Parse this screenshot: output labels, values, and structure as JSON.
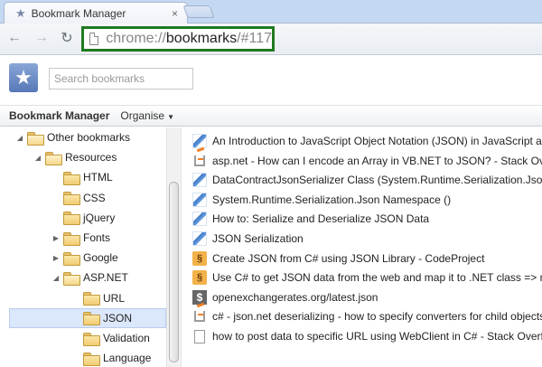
{
  "tab": {
    "title": "Bookmark Manager",
    "icon": "star-icon",
    "close": "×"
  },
  "nav": {
    "back": "←",
    "forward": "→",
    "reload": "↻"
  },
  "omnibox": {
    "scheme": "chrome://",
    "host": "bookmarks",
    "path": "/#117",
    "highlight_color": "#1f7a1f"
  },
  "header": {
    "logo_glyph": "★",
    "search_placeholder": "Search bookmarks"
  },
  "titlebar": {
    "title": "Bookmark Manager",
    "organise": "Organise",
    "organise_caret": "▼"
  },
  "tree": {
    "items": [
      {
        "label": "Other bookmarks",
        "expanded": true,
        "twisty": "◢",
        "level": 0
      },
      {
        "label": "Resources",
        "expanded": true,
        "twisty": "◢",
        "level": 1
      },
      {
        "label": "HTML",
        "twisty": "",
        "level": 2
      },
      {
        "label": "CSS",
        "twisty": "",
        "level": 2
      },
      {
        "label": "jQuery",
        "twisty": "",
        "level": 2
      },
      {
        "label": "Fonts",
        "twisty": "▶",
        "level": 2
      },
      {
        "label": "Google",
        "twisty": "▶",
        "level": 2
      },
      {
        "label": "ASP.NET",
        "expanded": true,
        "twisty": "◢",
        "level": 2
      },
      {
        "label": "URL",
        "twisty": "",
        "level": 3
      },
      {
        "label": "JSON",
        "twisty": "",
        "level": 3,
        "selected": true
      },
      {
        "label": "Validation",
        "twisty": "",
        "level": 3
      },
      {
        "label": "Language",
        "twisty": "",
        "level": 3
      }
    ]
  },
  "bookmarks": [
    {
      "title": "An Introduction to JavaScript Object Notation (JSON) in JavaScript and .NET",
      "icon": "msdn-icon"
    },
    {
      "title": "asp.net - How can I encode an Array in VB.NET to JSON? - Stack Overflow",
      "icon": "stackoverflow-icon"
    },
    {
      "title": "DataContractJsonSerializer Class (System.Runtime.Serialization.Json)",
      "icon": "msdn-icon"
    },
    {
      "title": "System.Runtime.Serialization.Json Namespace ()",
      "icon": "msdn-icon"
    },
    {
      "title": "How to: Serialize and Deserialize JSON Data",
      "icon": "msdn-icon"
    },
    {
      "title": "JSON Serialization",
      "icon": "msdn-icon"
    },
    {
      "title": "Create JSON from C# using JSON Library - CodeProject",
      "icon": "codeproject-icon"
    },
    {
      "title": "Use C# to get JSON data from the web and map it to .NET class => made easy",
      "icon": "codeproject-icon"
    },
    {
      "title": "openexchangerates.org/latest.json",
      "icon": "dollar-icon"
    },
    {
      "title": "c# - json.net deserializing - how to specify converters for child objects",
      "icon": "stackoverflow-icon"
    },
    {
      "title": "how to post data to specific URL using WebClient in C# - Stack Overflow",
      "icon": "page-icon"
    }
  ]
}
